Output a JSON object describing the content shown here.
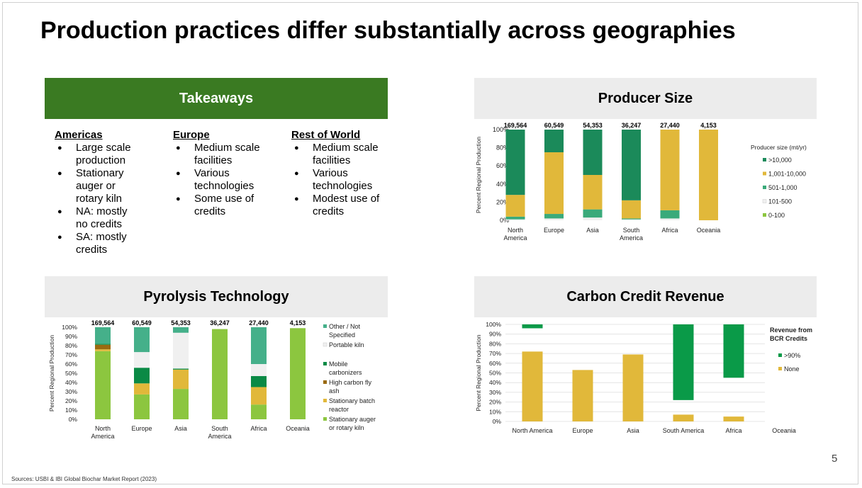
{
  "title": "Production practices differ substantially across geographies",
  "takeaways": {
    "heading": "Takeaways",
    "columns": [
      {
        "title": "Americas",
        "items": [
          "Large scale production",
          "Stationary auger or rotary kiln",
          "NA: mostly no credits",
          "SA: mostly credits"
        ]
      },
      {
        "title": "Europe",
        "items": [
          "Medium scale facilities",
          "Various technologies",
          "Some use of credits"
        ]
      },
      {
        "title": "Rest of World",
        "items": [
          "Medium scale facilities",
          "Various technologies",
          "Modest use of credits"
        ]
      }
    ]
  },
  "source": "Sources: USBI & IBI Global Biochar Market Report (2023)",
  "page_number": "5",
  "chart_data": [
    {
      "id": "producer",
      "type": "bar",
      "stacked": true,
      "title": "Producer Size",
      "ylabel": "Percent Regional Production",
      "ylim": [
        0,
        100
      ],
      "yticks": [
        "0%",
        "20%",
        "40%",
        "60%",
        "80%",
        "100%"
      ],
      "categories": [
        "North America",
        "Europe",
        "Asia",
        "South America",
        "Africa",
        "Oceania"
      ],
      "totals": [
        "169,564",
        "60,549",
        "54,353",
        "36,247",
        "27,440",
        "4,153"
      ],
      "legend_title": "Producer size (mt/yr)",
      "series": [
        {
          "name": "0-100",
          "color": "#8cc63f",
          "values": [
            0,
            0,
            0,
            0,
            0,
            0
          ]
        },
        {
          "name": "101-500",
          "color": "#f0f0f0",
          "values": [
            1,
            2,
            3,
            1,
            2,
            0
          ]
        },
        {
          "name": "501-1,000",
          "color": "#3aaa7a",
          "values": [
            3,
            5,
            9,
            1,
            9,
            0
          ]
        },
        {
          "name": "1,001-10,000",
          "color": "#e1b83a",
          "values": [
            24,
            68,
            38,
            20,
            89,
            100
          ]
        },
        {
          "name": ">10,000",
          "color": "#1b8a5a",
          "values": [
            72,
            25,
            50,
            78,
            0,
            0
          ]
        }
      ]
    },
    {
      "id": "pyrolysis",
      "type": "bar",
      "stacked": true,
      "title": "Pyrolysis Technology",
      "ylabel": "Percent Regional Production",
      "ylim": [
        0,
        100
      ],
      "yticks": [
        "0%",
        "10%",
        "20%",
        "30%",
        "40%",
        "50%",
        "60%",
        "70%",
        "80%",
        "90%",
        "100%"
      ],
      "categories": [
        "North America",
        "Europe",
        "Asia",
        "South America",
        "Africa",
        "Oceania"
      ],
      "totals": [
        "169,564",
        "60,549",
        "54,353",
        "36,247",
        "27,440",
        "4,153"
      ],
      "series": [
        {
          "name": "Stationary auger or rotary kiln",
          "color": "#8cc63f",
          "values": [
            74,
            27,
            33,
            98,
            16,
            99
          ]
        },
        {
          "name": "Stationary batch reactor",
          "color": "#e1b83a",
          "values": [
            2,
            12,
            21,
            0,
            19,
            0
          ]
        },
        {
          "name": "High carbon fly ash",
          "color": "#9a6a10",
          "values": [
            5,
            0,
            0,
            0,
            0,
            0
          ]
        },
        {
          "name": "Mobile carbonizers",
          "color": "#0a8a45",
          "values": [
            1,
            17,
            1,
            0,
            12,
            0
          ]
        },
        {
          "name": "Portable kiln",
          "color": "#f0f0f0",
          "values": [
            0,
            17,
            39,
            0,
            13,
            0
          ]
        },
        {
          "name": "Other / Not Specified",
          "color": "#45b08a",
          "values": [
            18,
            27,
            6,
            0,
            40,
            0
          ]
        }
      ]
    },
    {
      "id": "carbon",
      "type": "bar",
      "title": "Carbon Credit Revenue",
      "ylabel": "Percent Regional Production",
      "ylim": [
        0,
        100
      ],
      "yticks": [
        "0%",
        "10%",
        "20%",
        "30%",
        "40%",
        "50%",
        "60%",
        "70%",
        "80%",
        "90%",
        "100%"
      ],
      "categories": [
        "North America",
        "Europe",
        "Asia",
        "South America",
        "Africa",
        "Oceania"
      ],
      "legend_title": "Revenue from BCR Credits",
      "series": [
        {
          "name": ">90%",
          "color": "#0a9a48",
          "ranges": [
            [
              96,
              100
            ],
            null,
            null,
            [
              22,
              100
            ],
            [
              45,
              100
            ],
            null
          ]
        },
        {
          "name": "None",
          "color": "#e1b83a",
          "ranges": [
            [
              0,
              72
            ],
            [
              0,
              53
            ],
            [
              0,
              69
            ],
            [
              0,
              7
            ],
            [
              0,
              5
            ],
            null
          ]
        }
      ]
    }
  ]
}
